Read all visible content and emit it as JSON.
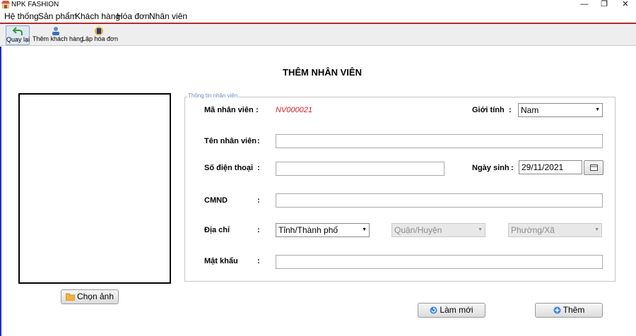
{
  "window": {
    "title": "NPK FASHION",
    "minimize_glyph": "—",
    "restore_glyph": "❐",
    "close_glyph": "✕"
  },
  "menu": [
    "Hệ thống",
    "Sản phẩm",
    "Khách hàng",
    "Hóa đơn",
    "Nhân viên"
  ],
  "toolbar": {
    "back": "Quay lại",
    "add_customer": "Thêm khách hàng",
    "create_invoice": "Lập hóa đơn"
  },
  "page_title": "THÊM NHÂN VIÊN",
  "photo": {
    "button_label": "Chọn ảnh"
  },
  "form": {
    "group_title": "Thông tin nhân viên",
    "colon": ":",
    "employee_id_label": "Mã nhân viên",
    "employee_id_value": "NV000021",
    "gender_label": "Giới tính",
    "gender_value": "Nam",
    "name_label": "Tên nhân viên",
    "name_value": "",
    "phone_label": "Số điện thoại",
    "phone_value": "",
    "birthdate_label": "Ngày sinh",
    "birthdate_value": "29/11/2021",
    "id_card_label": "CMND",
    "id_card_value": "",
    "address_label": "Địa chỉ",
    "province_value": "Tỉnh/Thành phố",
    "district_value": "Quận/Huyện",
    "ward_value": "Phường/Xã",
    "password_label": "Mật khẩu",
    "password_value": ""
  },
  "actions": {
    "refresh": "Làm mới",
    "add": "Thêm"
  },
  "colors": {
    "accent_red": "#b2292e",
    "id_red": "#d3202a",
    "left_border_blue": "#1e2ac8",
    "group_title_blue": "#6f8dbf"
  },
  "icons": [
    "store-icon",
    "back-arrow-icon",
    "add-customer-icon",
    "invoice-icon",
    "calendar-icon",
    "folder-icon",
    "refresh-icon",
    "plus-circle-icon"
  ]
}
